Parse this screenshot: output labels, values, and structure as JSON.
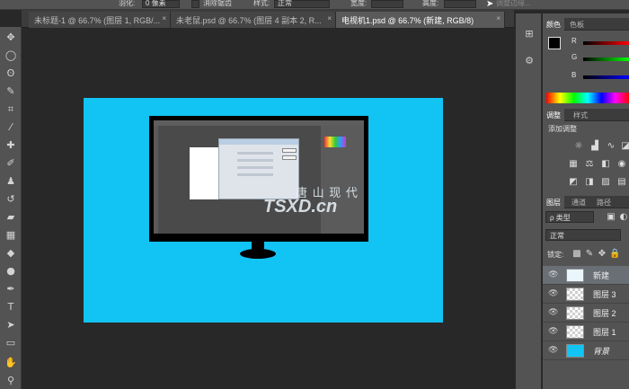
{
  "options_bar": {
    "feather_label": "羽化:",
    "feather_value": "0 像素",
    "antialias_label": "消除锯齿",
    "style_label": "样式:",
    "style_value": "正常",
    "width_label": "宽度:",
    "height_label": "高度:",
    "refine_edge": "调整边缘..."
  },
  "tabs": [
    {
      "title": "未标题-1 @ 66.7% (图层 1, RGB/...",
      "close": "×"
    },
    {
      "title": "未老鼠.psd @ 66.7% (图层 4 副本 2, R...",
      "close": "×"
    },
    {
      "title": "电视机1.psd @ 66.7% (新建, RGB/8)",
      "close": "×",
      "active": true
    }
  ],
  "canvas": {
    "background_color": "#12c4f4",
    "watermark_cn": "唐 山 现 代",
    "watermark_en": "TSXD.cn"
  },
  "color_panel": {
    "tabs": [
      "颜色",
      "色板"
    ],
    "channels": [
      "R",
      "G",
      "B"
    ]
  },
  "adjust_panel": {
    "tabs": [
      "调整",
      "样式"
    ],
    "title": "添加调整"
  },
  "layers_panel": {
    "tabs": [
      "图层",
      "通道",
      "路径"
    ],
    "filter_kind": "ρ 类型",
    "blend_mode": "正常",
    "lock_label": "锁定:",
    "layers": [
      {
        "name": "新建",
        "selected": true
      },
      {
        "name": "图层 3"
      },
      {
        "name": "图层 2"
      },
      {
        "name": "图层 1"
      },
      {
        "name": "背景"
      }
    ]
  }
}
